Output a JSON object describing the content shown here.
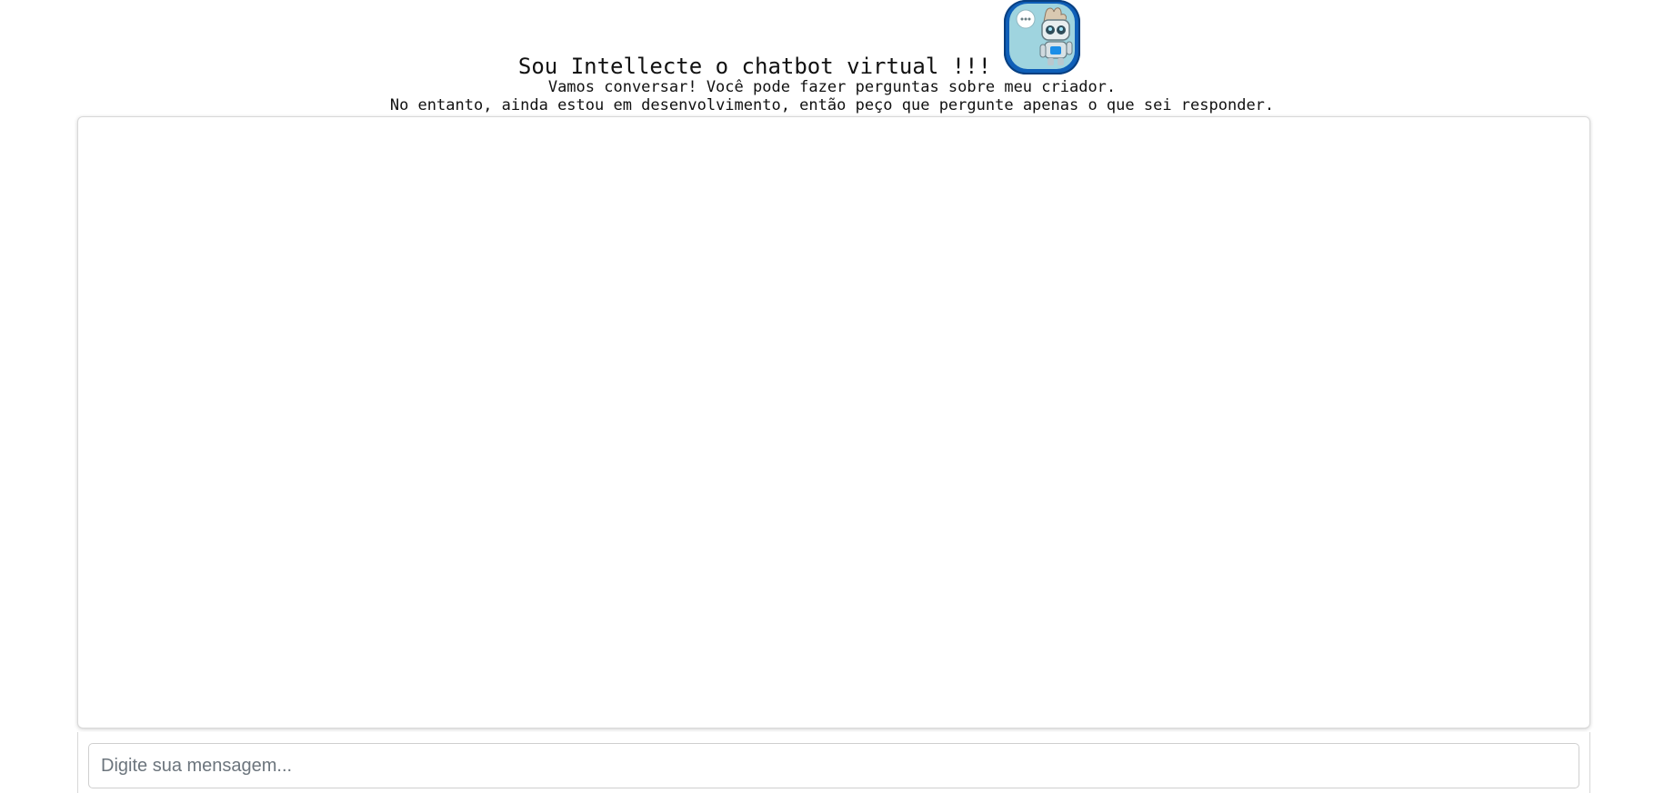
{
  "header": {
    "title": "Sou Intellecte o chatbot virtual !!!",
    "subtitle_line1": "Vamos conversar! Você pode fazer perguntas sobre meu criador.",
    "subtitle_line2": "No entanto, ainda estou em desenvolvimento, então peço que pergunte apenas o que sei responder.",
    "avatar_icon": "robot-avatar-icon",
    "avatar_border_color": "#0f5fb8"
  },
  "chat": {
    "messages": []
  },
  "composer": {
    "placeholder": "Digite sua mensagem...",
    "value": ""
  }
}
